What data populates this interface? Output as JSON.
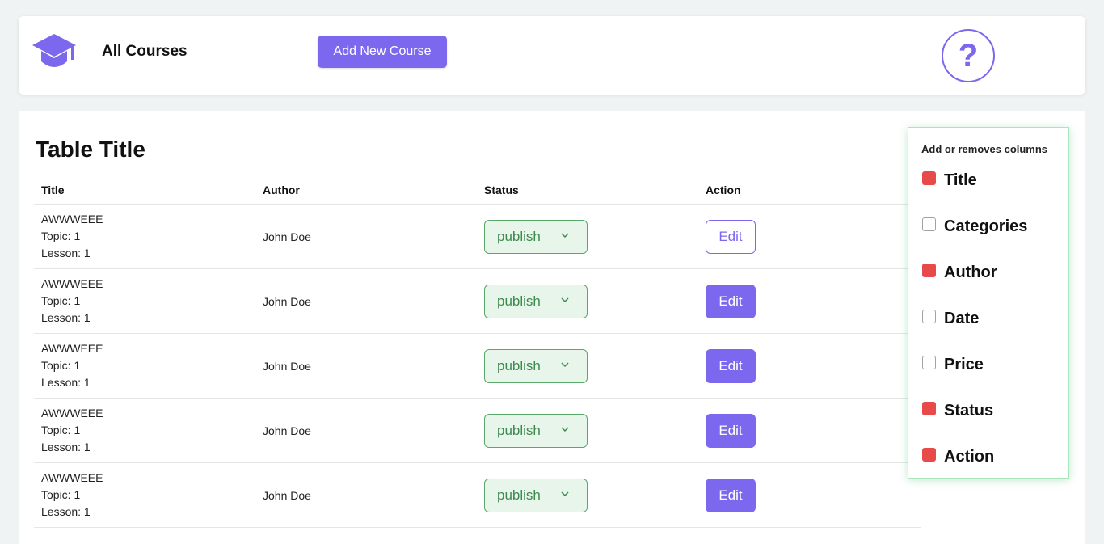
{
  "header": {
    "title": "All Courses",
    "add_button": "Add New Course",
    "help_symbol": "?"
  },
  "main": {
    "table_title": "Table Title",
    "columns": [
      "Title",
      "Author",
      "Status",
      "Action"
    ],
    "rows": [
      {
        "title": "AWWWEEE",
        "topic": "Topic: 1",
        "lesson": "Lesson: 1",
        "author": "John Doe",
        "status": "publish",
        "action": "Edit"
      },
      {
        "title": "AWWWEEE",
        "topic": "Topic: 1",
        "lesson": "Lesson: 1",
        "author": "John Doe",
        "status": "publish",
        "action": "Edit"
      },
      {
        "title": "AWWWEEE",
        "topic": "Topic: 1",
        "lesson": "Lesson: 1",
        "author": "John Doe",
        "status": "publish",
        "action": "Edit"
      },
      {
        "title": "AWWWEEE",
        "topic": "Topic: 1",
        "lesson": "Lesson: 1",
        "author": "John Doe",
        "status": "publish",
        "action": "Edit"
      },
      {
        "title": "AWWWEEE",
        "topic": "Topic: 1",
        "lesson": "Lesson: 1",
        "author": "John Doe",
        "status": "publish",
        "action": "Edit"
      }
    ]
  },
  "column_picker": {
    "title": "Add or removes columns",
    "options": [
      {
        "label": "Title",
        "checked": true
      },
      {
        "label": "Categories",
        "checked": false
      },
      {
        "label": "Author",
        "checked": true
      },
      {
        "label": "Date",
        "checked": false
      },
      {
        "label": "Price",
        "checked": false
      },
      {
        "label": "Status",
        "checked": true
      },
      {
        "label": "Action",
        "checked": true
      }
    ]
  },
  "colors": {
    "accent": "#7b68ee",
    "status_green": "#3d8a4e",
    "checked_red": "#e84a4a"
  },
  "icons": {
    "logo": "graduation-cap-icon",
    "help": "question-circle-icon",
    "status_dropdown": "chevron-down-icon"
  }
}
